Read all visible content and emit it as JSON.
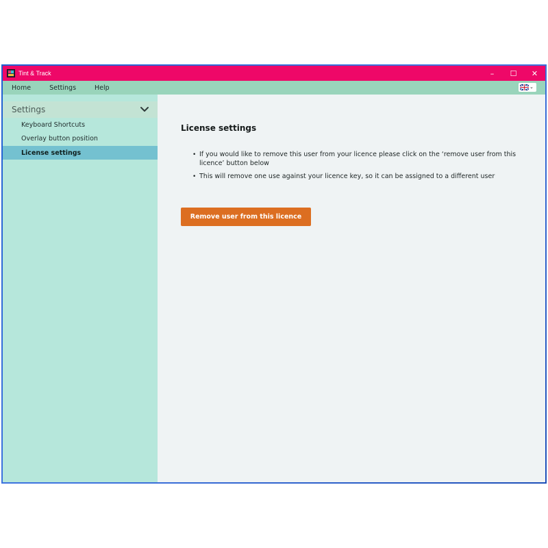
{
  "window": {
    "title": "Tint & Track",
    "controls": {
      "minimize": "–",
      "maximize": "☐",
      "close": "✕"
    }
  },
  "menubar": {
    "items": [
      {
        "label": "Home"
      },
      {
        "label": "Settings"
      },
      {
        "label": "Help"
      }
    ],
    "language": {
      "flag": "uk-flag-icon",
      "chevron": "⌄"
    }
  },
  "sidebar": {
    "header": "Settings",
    "items": [
      {
        "label": "Keyboard Shortcuts",
        "active": false
      },
      {
        "label": "Overlay button position",
        "active": false
      },
      {
        "label": "License settings",
        "active": true
      }
    ]
  },
  "content": {
    "title": "License settings",
    "bullets": [
      "If you would like to remove this user from your licence please click on the ‘remove user from this licence’ button below",
      "This will remove one use against your licence key, so it can be assigned to a different user"
    ],
    "button_label": "Remove user from this licence"
  },
  "colors": {
    "titlebar": "#ee0868",
    "menubar": "#99d4bb",
    "sidebar": "#b6e7db",
    "sidebar_active": "#74c1d0",
    "content_bg": "#eff3f4",
    "button": "#dc6e21"
  }
}
